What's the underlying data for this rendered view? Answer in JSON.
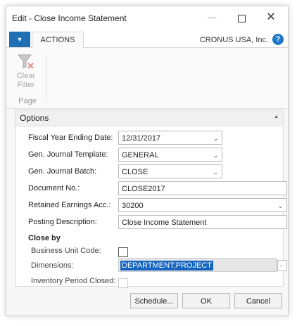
{
  "window": {
    "title": "Edit - Close Income Statement",
    "min_glyph": "—",
    "close_glyph": "✕"
  },
  "ribbon": {
    "menu_glyph": "▼",
    "tab_actions": "ACTIONS",
    "company": "CRONUS USA, Inc.",
    "help_glyph": "?",
    "clear_filter_label": "Clear Filter",
    "clear_filter_icon": "filter-clear-icon",
    "group_label": "Page"
  },
  "options": {
    "title": "Options",
    "collapse_glyph": "▲",
    "fiscal_year_ending_date": {
      "label": "Fiscal Year Ending Date:",
      "value": "12/31/2017"
    },
    "gen_journal_template": {
      "label": "Gen. Journal Template:",
      "value": "GENERAL"
    },
    "gen_journal_batch": {
      "label": "Gen. Journal Batch:",
      "value": "CLOSE"
    },
    "document_no": {
      "label": "Document No.:",
      "value": "CLOSE2017"
    },
    "retained_earnings_acc": {
      "label": "Retained Earnings Acc.:",
      "value": "30200"
    },
    "posting_description": {
      "label": "Posting Description:",
      "value": "Close Income Statement"
    },
    "close_by": {
      "heading": "Close by",
      "business_unit_code": {
        "label": "Business Unit Code:",
        "checked": false
      },
      "dimensions": {
        "label": "Dimensions:",
        "value": "DEPARTMENT;PROJECT",
        "assist": "..."
      },
      "inventory_period_closed": {
        "label": "Inventory Period Closed:",
        "checked": false
      }
    },
    "chevron_glyph": "⌄"
  },
  "footer": {
    "schedule": "Schedule...",
    "ok": "OK",
    "cancel": "Cancel"
  }
}
